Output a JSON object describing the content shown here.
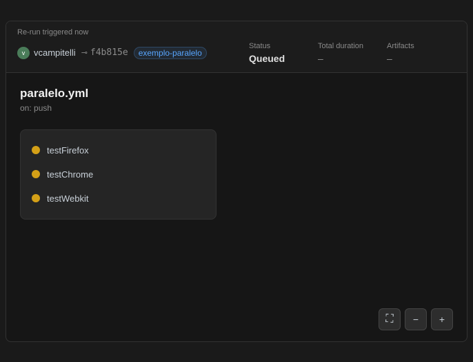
{
  "topBar": {
    "rerunLabel": "Re-run triggered now",
    "username": "vcampitelli",
    "commitHash": "f4b815e",
    "branch": "exemplo-paralelo",
    "status": {
      "label": "Status",
      "value": "Queued"
    },
    "duration": {
      "label": "Total duration",
      "value": "–"
    },
    "artifacts": {
      "label": "Artifacts",
      "value": "–"
    }
  },
  "main": {
    "workflowTitle": "paralelo.yml",
    "workflowTrigger": "on: push",
    "jobs": [
      {
        "name": "testFirefox"
      },
      {
        "name": "testChrome"
      },
      {
        "name": "testWebkit"
      }
    ]
  },
  "controls": {
    "fitIcon": "⛶",
    "zoomOutLabel": "−",
    "zoomInLabel": "+"
  }
}
